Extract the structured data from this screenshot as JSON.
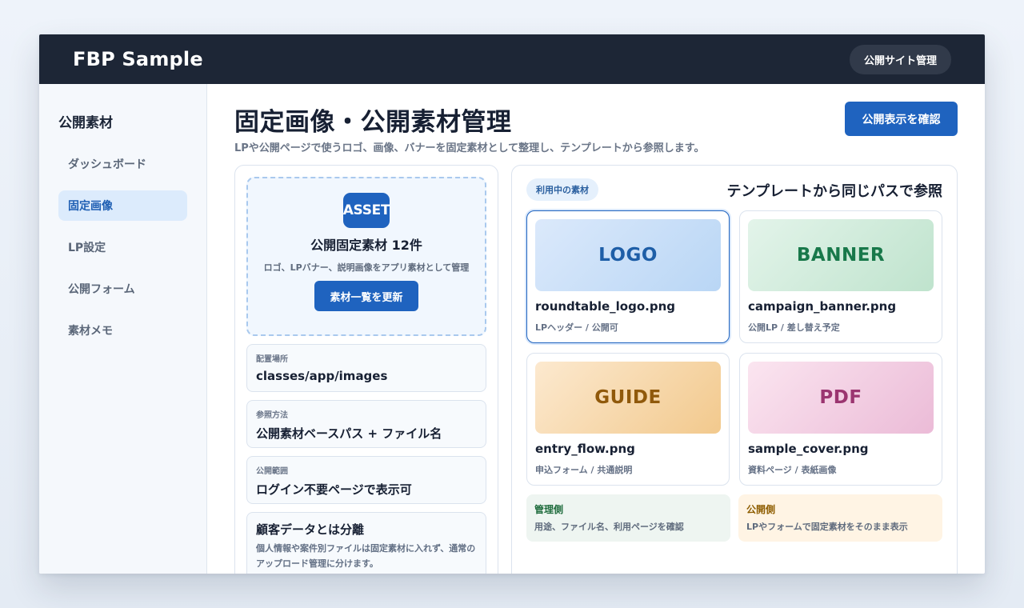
{
  "header": {
    "brand": "FBP Sample",
    "admin_label": "公開サイト管理"
  },
  "sidebar": {
    "title": "公開素材",
    "items": [
      {
        "label": "ダッシュボード",
        "active": false
      },
      {
        "label": "固定画像",
        "active": true
      },
      {
        "label": "LP設定",
        "active": false
      },
      {
        "label": "公開フォーム",
        "active": false
      },
      {
        "label": "素材メモ",
        "active": false
      }
    ]
  },
  "page": {
    "title": "固定画像・公開素材管理",
    "subtitle": "LPや公開ページで使うロゴ、画像、バナーを固定素材として整理し、テンプレートから参照します。",
    "confirm_button": "公開表示を確認"
  },
  "upload_panel": {
    "icon_label": "ASSET",
    "count_label": "公開固定素材 12件",
    "description": "ロゴ、LPバナー、説明画像をアプリ素材として管理",
    "refresh_button": "素材一覧を更新",
    "info_cards": [
      {
        "label": "配置場所",
        "value": "classes/app/images"
      },
      {
        "label": "参照方法",
        "value": "公開素材ベースパス + ファイル名"
      },
      {
        "label": "公開範囲",
        "value": "ログイン不要ページで表示可"
      }
    ],
    "note": {
      "title": "顧客データとは分離",
      "body": "個人情報や案件別ファイルは固定素材に入れず、通常のアップロード管理に分けます。"
    }
  },
  "assets_panel": {
    "tag": "利用中の素材",
    "heading": "テンプレートから同じパスで参照",
    "assets": [
      {
        "thumb": "LOGO",
        "name": "roundtable_logo.png",
        "meta": "LPヘッダー / 公開可",
        "selected": true
      },
      {
        "thumb": "BANNER",
        "name": "campaign_banner.png",
        "meta": "公開LP / 差し替え予定",
        "selected": false
      },
      {
        "thumb": "GUIDE",
        "name": "entry_flow.png",
        "meta": "申込フォーム / 共通説明",
        "selected": false
      },
      {
        "thumb": "PDF",
        "name": "sample_cover.png",
        "meta": "資料ページ / 表紙画像",
        "selected": false
      }
    ],
    "admin_note": {
      "title": "管理側",
      "text": "用途、ファイル名、利用ページを確認"
    },
    "public_note": {
      "title": "公開側",
      "text": "LPやフォームで固定素材をそのまま表示"
    }
  },
  "colors": {
    "topbar": "#1d2636",
    "accent": "#1f63bf",
    "active_nav_bg": "#dcebfc",
    "page_bg": "#eef3fa"
  },
  "icons": {
    "asset": "asset-icon"
  }
}
